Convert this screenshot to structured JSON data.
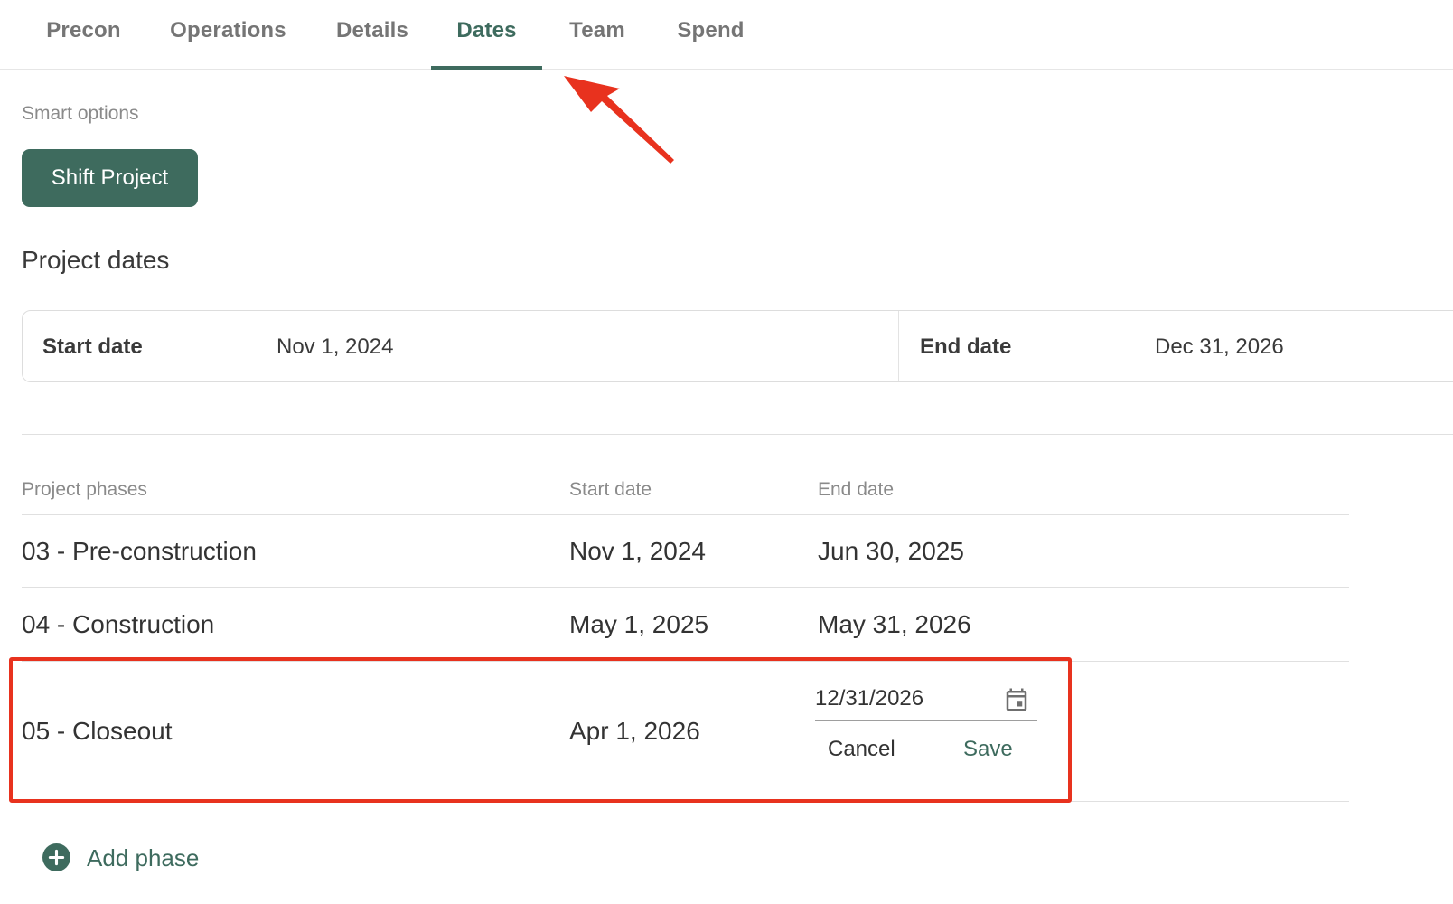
{
  "tabs": [
    {
      "label": "Precon",
      "active": false
    },
    {
      "label": "Operations",
      "active": false
    },
    {
      "label": "Details",
      "active": false
    },
    {
      "label": "Dates",
      "active": true
    },
    {
      "label": "Team",
      "active": false
    },
    {
      "label": "Spend",
      "active": false
    }
  ],
  "smart_options": {
    "label": "Smart options",
    "shift_button": "Shift Project"
  },
  "project_dates": {
    "title": "Project dates",
    "start_label": "Start date",
    "start_value": "Nov 1, 2024",
    "end_label": "End date",
    "end_value": "Dec 31, 2026"
  },
  "phases": {
    "headers": [
      "Project phases",
      "Start date",
      "End date"
    ],
    "rows": [
      {
        "name": "03 - Pre-construction",
        "start": "Nov 1, 2024",
        "end": "Jun 30, 2025"
      },
      {
        "name": "04 - Construction",
        "start": "May 1, 2025",
        "end": "May 31, 2026"
      },
      {
        "name": "05 - Closeout",
        "start": "Apr 1, 2026",
        "end": "12/31/2026"
      }
    ],
    "edit_actions": {
      "cancel": "Cancel",
      "save": "Save"
    },
    "add_phase": "Add phase"
  },
  "colors": {
    "accent": "#3e6b5e",
    "annotation": "#e8321e"
  },
  "icons": {
    "calendar": "calendar-icon",
    "add": "add-circle-icon",
    "annotation_arrow": "red-arrow-icon"
  }
}
